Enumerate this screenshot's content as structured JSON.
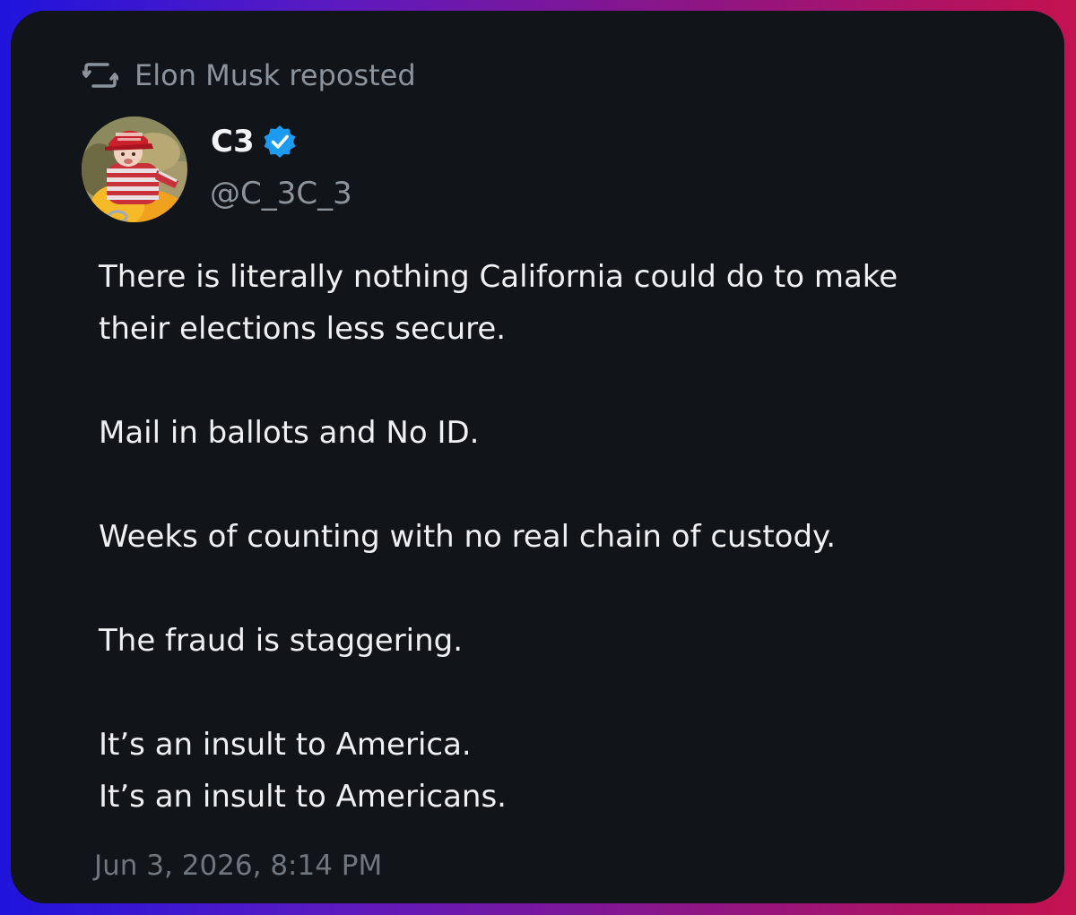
{
  "repost": {
    "label": "Elon Musk reposted",
    "icon": "repost-icon"
  },
  "author": {
    "display_name": "C3",
    "handle": "@C_3C_3",
    "verified": true,
    "verified_color": "#1d9bf0",
    "avatar_icon": "profile-photo"
  },
  "tweet": {
    "lines": [
      "There is literally nothing California could do to make",
      "their elections less secure.",
      "Mail in ballots and No ID.",
      "Weeks of counting with no real chain of custody.",
      "The fraud is staggering.",
      "It’s an insult to America.",
      "It’s an insult to Americans."
    ]
  },
  "timestamp": "Jun 3, 2026, 8:14 PM",
  "colors": {
    "card_bg": "#111519",
    "muted_text": "#8b949c",
    "body_text": "#eef0f2",
    "gradient_left": "#1f14dc",
    "gradient_right": "#c4124f"
  }
}
